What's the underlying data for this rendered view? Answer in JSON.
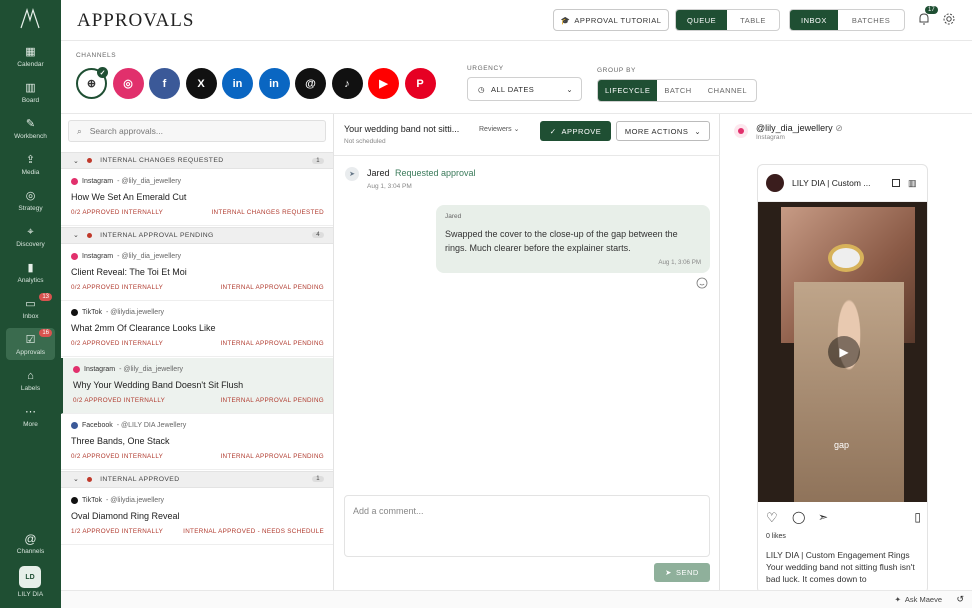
{
  "sidebar": {
    "logo": "M",
    "items": [
      {
        "label": "Calendar",
        "icon": "calendar-icon"
      },
      {
        "label": "Board",
        "icon": "board-icon"
      },
      {
        "label": "Workbench",
        "icon": "workbench-icon"
      },
      {
        "label": "Media",
        "icon": "upload-icon"
      },
      {
        "label": "Strategy",
        "icon": "compass-icon"
      },
      {
        "label": "Discovery",
        "icon": "telescope-icon"
      },
      {
        "label": "Analytics",
        "icon": "chart-icon"
      },
      {
        "label": "Inbox",
        "icon": "inbox-icon",
        "badge": "13"
      },
      {
        "label": "Approvals",
        "icon": "approval-icon",
        "badge": "16",
        "active": true
      },
      {
        "label": "Labels",
        "icon": "tag-icon"
      },
      {
        "label": "More",
        "icon": "more-icon"
      }
    ],
    "channels_label": "Channels",
    "user_initials": "LD",
    "user_name": "LILY DIA"
  },
  "topbar": {
    "title": "APPROVALS",
    "tutorial": "APPROVAL TUTORIAL",
    "view_queue": "QUEUE",
    "view_table": "TABLE",
    "mode_inbox": "INBOX",
    "mode_batches": "BATCHES",
    "notif_count": "17"
  },
  "channels": {
    "label": "CHANNELS",
    "list": [
      {
        "name": "all-channels",
        "glyph": "⊕",
        "color": "#ffffff"
      },
      {
        "name": "instagram",
        "glyph": "◎",
        "color": "#e1306c"
      },
      {
        "name": "facebook",
        "glyph": "f",
        "color": "#3b5998"
      },
      {
        "name": "x",
        "glyph": "X",
        "color": "#111111"
      },
      {
        "name": "linkedin",
        "glyph": "in",
        "color": "#0a66c2"
      },
      {
        "name": "linkedin-page",
        "glyph": "in",
        "color": "#0a66c2"
      },
      {
        "name": "threads",
        "glyph": "@",
        "color": "#111111"
      },
      {
        "name": "tiktok",
        "glyph": "♪",
        "color": "#111111"
      },
      {
        "name": "youtube",
        "glyph": "▶",
        "color": "#ff0000"
      },
      {
        "name": "pinterest",
        "glyph": "P",
        "color": "#e60023"
      }
    ],
    "urgency_label": "URGENCY",
    "urgency_value": "ALL DATES",
    "group_label": "GROUP BY",
    "group_options": [
      "LIFECYCLE",
      "BATCH",
      "CHANNEL"
    ]
  },
  "list": {
    "search_placeholder": "Search approvals...",
    "groups": [
      {
        "label": "INTERNAL CHANGES REQUESTED",
        "count": "1",
        "items": [
          {
            "platform": "Instagram",
            "handle": " - @lily_dia_jewellery",
            "title": "How We Set An Emerald Cut",
            "approved": "0/2 APPROVED INTERNALLY",
            "status": "INTERNAL CHANGES REQUESTED",
            "color": "#e1306c"
          }
        ]
      },
      {
        "label": "INTERNAL APPROVAL PENDING",
        "count": "4",
        "items": [
          {
            "platform": "Instagram",
            "handle": " - @lily_dia_jewellery",
            "title": "Client Reveal: The Toi Et Moi",
            "approved": "0/2 APPROVED INTERNALLY",
            "status": "INTERNAL APPROVAL PENDING",
            "color": "#e1306c"
          },
          {
            "platform": "TikTok",
            "handle": " - @lilydia.jewellery",
            "title": "What 2mm Of Clearance Looks Like",
            "approved": "0/2 APPROVED INTERNALLY",
            "status": "INTERNAL APPROVAL PENDING",
            "color": "#111111"
          },
          {
            "platform": "Instagram",
            "handle": " - @lily_dia_jewellery",
            "title": "Why Your Wedding Band Doesn't Sit Flush",
            "approved": "0/2 APPROVED INTERNALLY",
            "status": "INTERNAL APPROVAL PENDING",
            "color": "#e1306c"
          },
          {
            "platform": "Facebook",
            "handle": " - @LILY DIA Jewellery",
            "title": "Three Bands, One Stack",
            "approved": "0/2 APPROVED INTERNALLY",
            "status": "INTERNAL APPROVAL PENDING",
            "color": "#3b5998"
          }
        ]
      },
      {
        "label": "INTERNAL APPROVED",
        "count": "1",
        "items": [
          {
            "platform": "TikTok",
            "handle": " - @lilydia.jewellery",
            "title": "Oval Diamond Ring Reveal",
            "approved": "1/2 APPROVED INTERNALLY",
            "status": "INTERNAL APPROVED - NEEDS SCHEDULE",
            "color": "#111111"
          }
        ]
      }
    ]
  },
  "conversation": {
    "title": "Your wedding band not sitti...",
    "subtitle": "Not scheduled",
    "reviewers": "Reviewers",
    "approve": "APPROVE",
    "more_actions": "MORE ACTIONS",
    "event_name": "Jared",
    "event_action": "Requested approval",
    "event_time": "Aug 1, 3:04 PM",
    "msg_author": "Jared",
    "msg_text": "Swapped the cover to the close-up of the gap between the rings. Much clearer before the explainer starts.",
    "msg_time": "Aug 1, 3:06 PM",
    "compose_placeholder": "Add a comment...",
    "send": "SEND"
  },
  "preview": {
    "account": "@lily_dia_jewellery",
    "platform": "Instagram",
    "card_title": "LILY DIA | Custom ...",
    "video_caption": "gap",
    "likes": "0 likes",
    "caption_bold": "LILY DIA | Custom Engagement Rings",
    "caption_text": " Your wedding band not sitting flush isn't bad luck. It comes down to"
  },
  "footer": {
    "ask": "Ask Maeve"
  }
}
